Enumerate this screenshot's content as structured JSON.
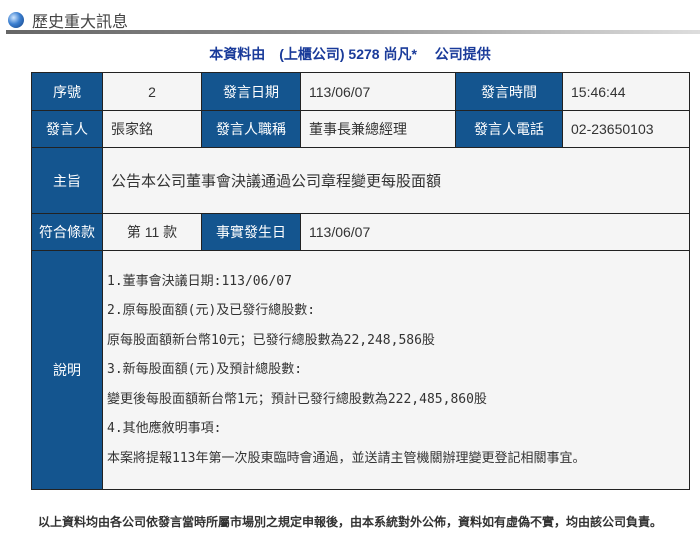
{
  "header": {
    "title": "歷史重大訊息"
  },
  "subtitle": "本資料由　(上櫃公司) 5278 尚凡*　 公司提供",
  "fields": {
    "seq_label": "序號",
    "seq": "2",
    "date_label": "發言日期",
    "date": "113/06/07",
    "time_label": "發言時間",
    "time": "15:46:44",
    "speaker_label": "發言人",
    "speaker": "張家銘",
    "title_label": "發言人職稱",
    "title": "董事長兼總經理",
    "phone_label": "發言人電話",
    "phone": "02-23650103",
    "subject_label": "主旨",
    "subject": "公告本公司董事會決議通過公司章程變更每股面額",
    "clause_label": "符合條款",
    "clause": "第 11 款",
    "event_date_label": "事實發生日",
    "event_date": "113/06/07",
    "desc_label": "說明",
    "desc_lines": [
      "1.董事會決議日期:113/06/07",
      "2.原每股面額(元)及已發行總股數:",
      "原每股面額新台幣10元；已發行總股數為22,248,586股",
      "3.新每股面額(元)及預計總股數:",
      "變更後每股面額新台幣1元；預計已發行總股數為222,485,860股",
      "4.其他應敘明事項:",
      "本案將提報113年第一次股東臨時會通過，並送請主管機關辦理變更登記相關事宜。"
    ]
  },
  "footer": "以上資料均由各公司依發言當時所屬市場別之規定申報後，由本系統對外公佈，資料如有虛偽不實，均由該公司負責。"
}
